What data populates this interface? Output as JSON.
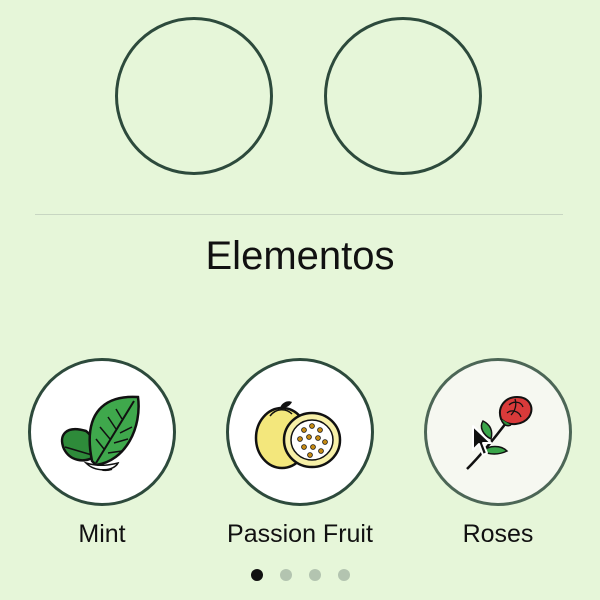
{
  "section": {
    "title": "Elementos"
  },
  "elements": [
    {
      "label": "Mint",
      "icon": "mint-leaves-icon"
    },
    {
      "label": "Passion Fruit",
      "icon": "passion-fruit-icon"
    },
    {
      "label": "Roses",
      "icon": "rose-icon"
    }
  ],
  "selected_slots": [
    {
      "state": "empty"
    },
    {
      "state": "empty"
    }
  ],
  "pager": {
    "page_count": 4,
    "current_page": 1
  },
  "colors": {
    "background": "#e6f6d9",
    "outline": "#2d4a3c",
    "dot_active": "#111111",
    "dot_inactive": "#b3c4b0"
  }
}
